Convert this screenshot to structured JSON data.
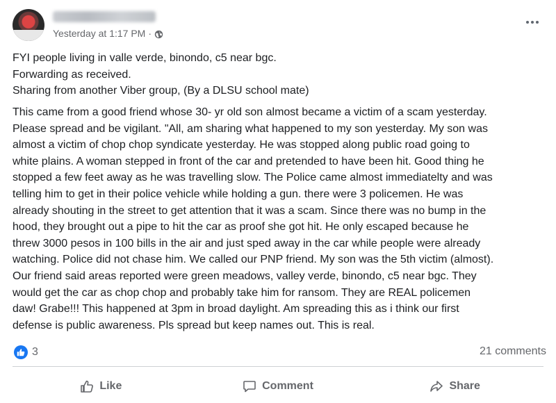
{
  "post": {
    "timestamp": "Yesterday at 1:17 PM",
    "separator": "·",
    "intro_lines": [
      "FYI people living in valle verde, binondo, c5 near bgc.",
      "Forwarding as received.",
      "Sharing from another Viber group, (By a DLSU school mate)"
    ],
    "story_lines": [
      "This came from a good friend whose 30- yr old son almost became a victim of a scam yesterday.",
      "Please spread and be vigilant. \"All, am sharing what happened to my son yesterday. My son was",
      "almost a victim of chop chop syndicate yesterday. He was stopped along public road going to",
      "white plains. A woman stepped in front of the car and pretended to have been hit. Good thing he",
      "stopped a few feet away as he was travelling slow. The Police came almost immediatelty and was",
      "telling him to get in their police vehicle while holding a gun. there were 3 policemen. He was",
      "already shouting in the street to get attention that it was a scam. Since there was no bump in the",
      "hood, they brought out a pipe to hit the car as proof she got hit. He only escaped because he",
      "threw 3000 pesos in 100 bills in the air and just sped away in the car while people were already",
      "watching. Police did not chase him. We called our PNP friend. My son was the 5th victim (almost).",
      "Our friend said areas reported were green meadows, valley verde, binondo, c5 near bgc. They",
      "would get the car as chop chop and probably take  him for ransom. They are REAL policemen",
      "daw! Grabe!!! This happened at 3pm in broad daylight. Am spreading this as i think our first",
      "defense is public awareness. Pls spread but keep names out. This is real."
    ],
    "reaction_count": "3",
    "comments_count": "21 comments"
  },
  "actions": {
    "like": "Like",
    "comment": "Comment",
    "share": "Share"
  },
  "icons": {
    "privacy": "globe-icon",
    "menu": "more-options-icon",
    "reaction": "like-reaction-icon"
  },
  "colors": {
    "text": "#1c1e21",
    "secondary": "#65676b",
    "accent": "#1877f2",
    "divider": "#ced0d4"
  }
}
